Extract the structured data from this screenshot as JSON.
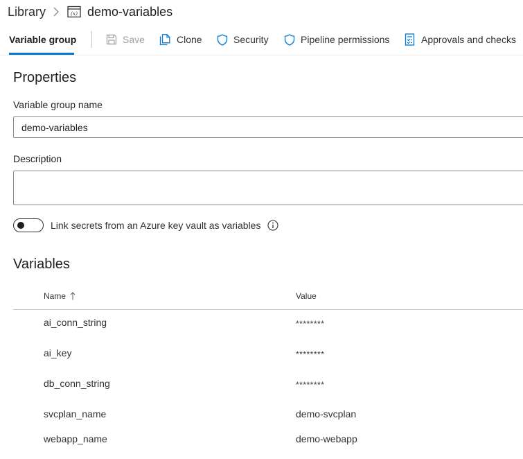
{
  "breadcrumb": {
    "root": "Library",
    "current": "demo-variables"
  },
  "toolbar": {
    "active_tab": "Variable group",
    "save": "Save",
    "clone": "Clone",
    "security": "Security",
    "pipeline_permissions": "Pipeline permissions",
    "approvals": "Approvals and checks"
  },
  "properties": {
    "title": "Properties",
    "name_label": "Variable group name",
    "name_value": "demo-variables",
    "description_label": "Description",
    "description_value": "",
    "keyvault_toggle_label": "Link secrets from an Azure key vault as variables",
    "keyvault_toggle_on": false
  },
  "variables": {
    "title": "Variables",
    "columns": {
      "name": "Name",
      "value": "Value"
    },
    "rows": [
      {
        "name": "ai_conn_string",
        "value": "********",
        "secret": true
      },
      {
        "name": "ai_key",
        "value": "********",
        "secret": true
      },
      {
        "name": "db_conn_string",
        "value": "********",
        "secret": true
      },
      {
        "name": "svcplan_name",
        "value": "demo-svcplan",
        "secret": false
      },
      {
        "name": "webapp_name",
        "value": "demo-webapp",
        "secret": false
      }
    ]
  },
  "colors": {
    "accent": "#0078d4",
    "text": "#201f1e",
    "disabled": "#a19f9d",
    "border": "#8a8886"
  }
}
